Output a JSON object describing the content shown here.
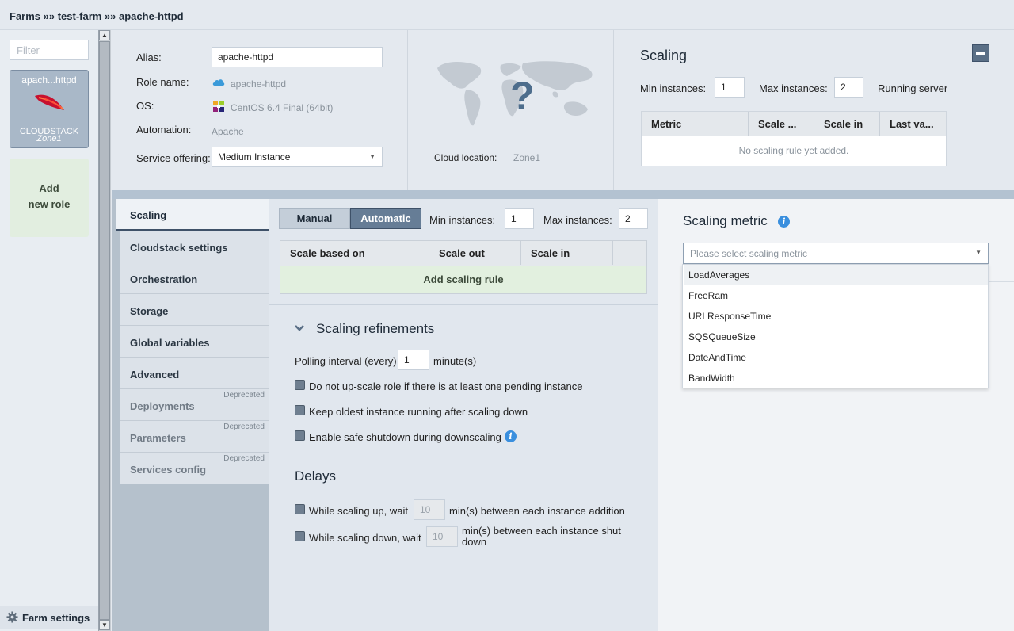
{
  "breadcrumb": "Farms »» test-farm »» apache-httpd",
  "sidebar": {
    "filter_placeholder": "Filter",
    "role_card": {
      "name": "apach...httpd",
      "platform": "CLOUDSTACK",
      "zone": "Zone1"
    },
    "add_role_line1": "Add",
    "add_role_line2": "new role",
    "farm_settings": "Farm settings"
  },
  "info": {
    "alias_label": "Alias:",
    "alias_value": "apache-httpd",
    "role_name_label": "Role name:",
    "role_name_value": "apache-httpd",
    "os_label": "OS:",
    "os_value": "CentOS 6.4 Final (64bit)",
    "automation_label": "Automation:",
    "automation_value": "Apache",
    "service_offering_label": "Service offering:",
    "service_offering_value": "Medium Instance",
    "cloud_location_label": "Cloud location:",
    "cloud_location_value": "Zone1"
  },
  "scaling_summary": {
    "title": "Scaling",
    "min_label": "Min instances:",
    "min_value": "1",
    "max_label": "Max instances:",
    "max_value": "2",
    "running_label": "Running servers",
    "columns": [
      "Metric",
      "Scale ...",
      "Scale in",
      "Last va..."
    ],
    "empty_text": "No scaling rule yet added."
  },
  "nav": {
    "items": [
      {
        "label": "Scaling"
      },
      {
        "label": "Cloudstack settings"
      },
      {
        "label": "Orchestration"
      },
      {
        "label": "Storage"
      },
      {
        "label": "Global variables"
      },
      {
        "label": "Advanced"
      },
      {
        "label": "Deployments",
        "badge": "Deprecated"
      },
      {
        "label": "Parameters",
        "badge": "Deprecated"
      },
      {
        "label": "Services config",
        "badge": "Deprecated"
      }
    ]
  },
  "scaling_panel": {
    "manual_label": "Manual",
    "automatic_label": "Automatic",
    "min_label": "Min instances:",
    "min_value": "1",
    "max_label": "Max instances:",
    "max_value": "2",
    "columns": [
      "Scale based on",
      "Scale out",
      "Scale in"
    ],
    "add_rule": "Add scaling rule",
    "refinements_title": "Scaling refinements",
    "polling_label": "Polling interval (every)",
    "polling_value": "1",
    "polling_unit": "minute(s)",
    "opt1": "Do not up-scale role if there is at least one pending instance",
    "opt2": "Keep oldest instance running after scaling down",
    "opt3": "Enable safe shutdown during downscaling",
    "delays_title": "Delays",
    "delay_up_label": "While scaling up, wait",
    "delay_up_value": "10",
    "delay_up_suffix": "min(s) between each instance addition",
    "delay_down_label": "While scaling down, wait",
    "delay_down_value": "10",
    "delay_down_suffix": "min(s) between each instance shut down"
  },
  "metric_panel": {
    "title": "Scaling metric",
    "placeholder": "Please select scaling metric",
    "options": [
      "LoadAverages",
      "FreeRam",
      "URLResponseTime",
      "SQSQueueSize",
      "DateAndTime",
      "BandWidth"
    ]
  }
}
